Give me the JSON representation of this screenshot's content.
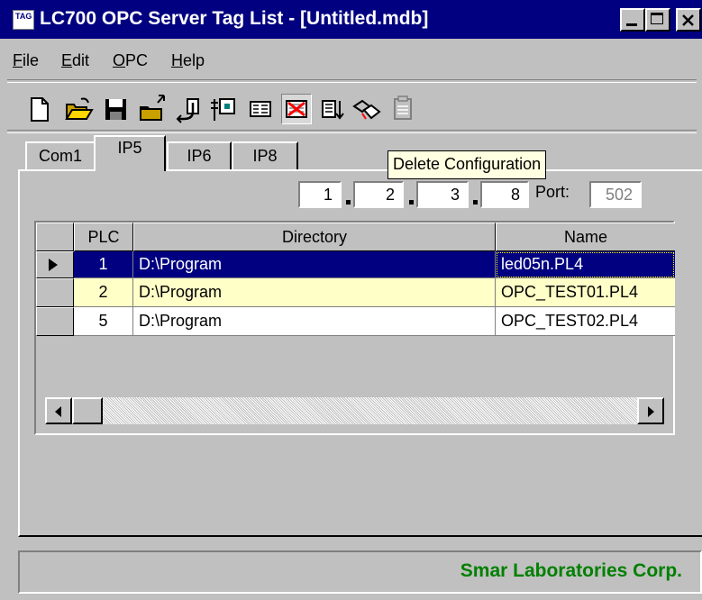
{
  "window": {
    "app_icon": "TAG",
    "title": "LC700 OPC Server Tag List - [Untitled.mdb]",
    "title_bar_color": "#000080"
  },
  "menu": [
    {
      "label": "File",
      "mnemonic": "F",
      "rest": "ile"
    },
    {
      "label": "Edit",
      "mnemonic": "E",
      "rest": "dit"
    },
    {
      "label": "OPC",
      "mnemonic": "O",
      "rest": "PC"
    },
    {
      "label": "Help",
      "mnemonic": "H",
      "rest": "elp"
    }
  ],
  "toolbar": {
    "icons": [
      "new-document-icon",
      "open-folder-icon",
      "save-disk-icon",
      "upload-folder-icon",
      "export-icon",
      "import-icon",
      "view-list-icon",
      "delete-configuration-icon",
      "sort-icon",
      "plc-link-icon",
      "disabled-report-icon"
    ],
    "hovered": "delete-configuration-icon"
  },
  "tooltip": {
    "text": "Delete Configuration"
  },
  "tabs": [
    {
      "label": "Com1",
      "active": false
    },
    {
      "label": "IP5",
      "active": true
    },
    {
      "label": "IP6",
      "active": false
    },
    {
      "label": "IP8",
      "active": false
    }
  ],
  "ip_address": {
    "octets": [
      "1",
      "2",
      "3",
      "8"
    ],
    "port_label": "Port:",
    "port": "502"
  },
  "grid": {
    "columns": [
      "PLC",
      "Directory",
      "Name"
    ],
    "rows": [
      {
        "plc": "1",
        "directory": "D:\\Program",
        "name": "led05n.PL4",
        "selected": true
      },
      {
        "plc": "2",
        "directory": "D:\\Program",
        "name": "OPC_TEST01.PL4",
        "highlight": true
      },
      {
        "plc": "5",
        "directory": "D:\\Program",
        "name": "OPC_TEST02.PL4"
      }
    ],
    "selected_color": "#000080",
    "highlight_color": "#ffffc8"
  },
  "status": {
    "text": "Smar Laboratories Corp.",
    "color": "#008000"
  }
}
